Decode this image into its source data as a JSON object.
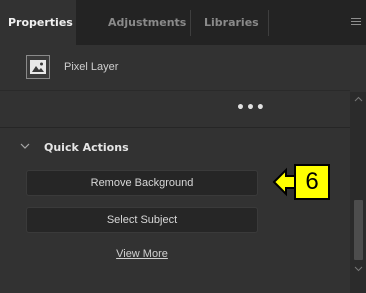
{
  "tabs": [
    {
      "label": "Properties",
      "active": true
    },
    {
      "label": "Adjustments",
      "active": false
    },
    {
      "label": "Libraries",
      "active": false
    }
  ],
  "layer": {
    "icon": "image-icon",
    "label": "Pixel Layer"
  },
  "more_dots": "•••",
  "quick_actions": {
    "title": "Quick Actions",
    "buttons": [
      "Remove Background",
      "Select Subject"
    ],
    "link": "View More"
  },
  "callout": {
    "number": "6",
    "color": "#ffff00"
  },
  "colors": {
    "panel": "#323232",
    "tabbar": "#232323",
    "button": "#262626"
  }
}
